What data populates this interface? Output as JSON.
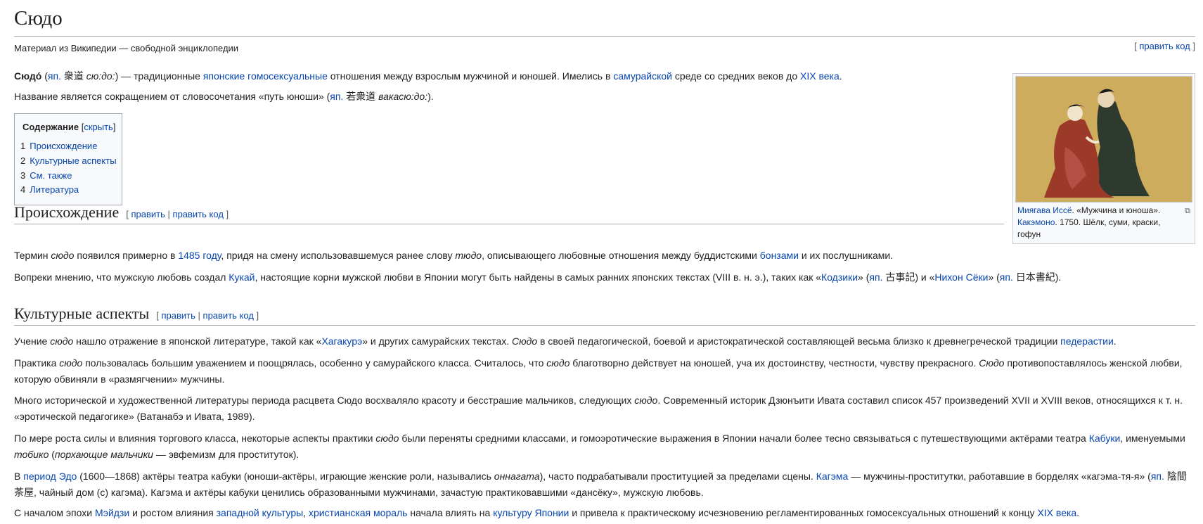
{
  "title": "Сюдо",
  "tagline": "Материал из Википедии — свободной энциклопедии",
  "edit_code_top": "править код",
  "bracket_open": "[",
  "bracket_close": "]",
  "sep": "|",
  "intro": {
    "p1": {
      "term": "Сюдо́",
      "t1": " (",
      "jap": "яп.",
      "kanji": " 衆道 ",
      "reading": "сю:до:",
      "t2": ") — традиционные ",
      "link1": "японские",
      "t3": " ",
      "link2": "гомосексуальные",
      "t4": " отношения между взрослым мужчиной и юношей. Имелись в ",
      "link3": "самурайской",
      "t5": " среде со средних веков до ",
      "link4": "XIX века",
      "t6": "."
    },
    "p2": {
      "t1": "Название является сокращением от словосочетания «путь юноши» (",
      "jap": "яп.",
      "kanji": " 若衆道 ",
      "reading": "вакасю:до:",
      "t2": ")."
    }
  },
  "toc": {
    "title": "Содержание",
    "toggle": "скрыть",
    "items": [
      {
        "num": "1",
        "label": "Происхождение"
      },
      {
        "num": "2",
        "label": "Культурные аспекты"
      },
      {
        "num": "3",
        "label": "См. также"
      },
      {
        "num": "4",
        "label": "Литература"
      }
    ]
  },
  "section_edit": {
    "edit": "править",
    "edit_code": "править код"
  },
  "sections": {
    "origin": {
      "heading": "Происхождение",
      "p1": {
        "t1": "Термин ",
        "i1": "сюдо",
        "t2": " появился примерно в ",
        "link1": "1485 году",
        "t3": ", придя на смену использовавшемуся ранее слову ",
        "i2": "тюдо",
        "t4": ", описывающего любовные отношения между буддистскими ",
        "link2": "бонзами",
        "t5": " и их послушниками."
      },
      "p2": {
        "t1": "Вопреки мнению, что мужскую любовь создал ",
        "link1": "Кукай",
        "t2": ", настоящие корни мужской любви в Японии могут быть найдены в самых ранних японских текстах (VIII в. н. э.), таких как «",
        "link2": "Кодзики",
        "t3": "» (",
        "jap1": "яп.",
        "kanji1": " 古事記",
        "t4": ") и «",
        "link3": "Нихон Сёки",
        "t5": "» (",
        "jap2": "яп.",
        "kanji2": " 日本書紀",
        "t6": ")."
      }
    },
    "culture": {
      "heading": "Культурные аспекты",
      "p1": {
        "t1": "Учение ",
        "i1": "сюдо",
        "t2": " нашло отражение в японской литературе, такой как «",
        "link1": "Хагакурэ",
        "t3": "» и других самурайских текстах. ",
        "i2": "Сюдо",
        "t4": " в своей педагогической, боевой и аристократической составляющей весьма близко к древнегреческой традиции ",
        "link2": "педерастии",
        "t5": "."
      },
      "p2": {
        "t1": "Практика ",
        "i1": "сюдо",
        "t2": " пользовалась большим уважением и поощрялась, особенно у самурайского класса. Считалось, что ",
        "i2": "сюдо",
        "t3": " благотворно действует на юношей, уча их достоинству, честности, чувству прекрасного. ",
        "i3": "Сюдо",
        "t4": " противопоставлялось женской любви, которую обвиняли в «размягчении» мужчины."
      },
      "p3": {
        "t1": "Много исторической и художественной литературы периода расцвета Сюдо восхваляло красоту и бесстрашие мальчиков, следующих ",
        "i1": "сюдо",
        "t2": ". Современный историк Дзюнъити Ивата составил список 457 произведений XVII и XVIII веков, относящихся к т. н. «эротической педагогике» (Ватанабэ и Ивата, 1989)."
      },
      "p4": {
        "t1": "По мере роста силы и влияния торгового класса, некоторые аспекты практики ",
        "i1": "сюдо",
        "t2": " были переняты средними классами, и гомоэротические выражения в Японии начали более тесно связываться с путешествующими актёрами театра ",
        "link1": "Кабуки",
        "t3": ", именуемыми ",
        "i2": "тобико",
        "t4": " (",
        "i3": "порхающие мальчики",
        "t5": " — эвфемизм для проституток)."
      },
      "p5": {
        "t1": "В ",
        "link1": "период Эдо",
        "t2": " (1600—1868) актёры театра кабуки (юноши-актёры, играющие женские роли, назывались ",
        "i1": "оннагата",
        "t3": "), часто подрабатывали проституцией за пределами сцены. ",
        "link2": "Кагэма",
        "t4": " — мужчины-проститутки, работавшие в борделях «кагэма-тя-я» (",
        "jap": "яп.",
        "t5": " 陰間茶屋, чайный дом (с) кагэма). Кагэма и актёры кабуки ценились образованными мужчинами, зачастую практиковавшими «дансёку», мужскую любовь."
      },
      "p6": {
        "t1": "С началом эпохи ",
        "link1": "Мэйдзи",
        "t2": " и ростом влияния ",
        "link2": "западной культуры",
        "t3": ", ",
        "link3": "христианская мораль",
        "t4": " начала влиять на ",
        "link4": "культуру Японии",
        "t5": " и привела к практическому исчезновению регламентированных гомосексуальных отношений к концу ",
        "link5": "XIX века",
        "t6": "."
      }
    }
  },
  "thumb": {
    "artist": "Миягава Иссё",
    "t1": ". «Мужчина и юноша». ",
    "link2": "Какэмоно",
    "t2": ". 1750. Шёлк, суми, краски, гофун"
  },
  "colors": {
    "link": "#0645ad",
    "text": "#202122",
    "rule": "#a2a9b1",
    "toc_bg": "#f8f9fa",
    "painting_bg": "#c9a656"
  }
}
